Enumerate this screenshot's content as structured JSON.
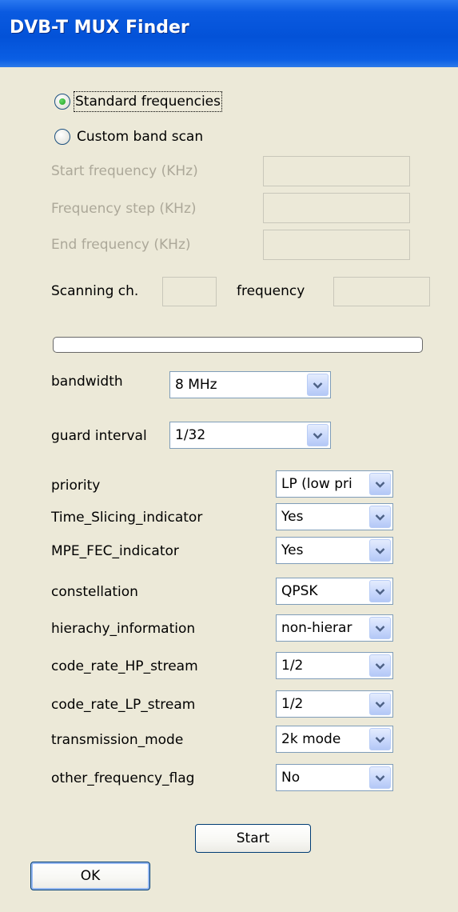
{
  "window": {
    "title": "DVB-T MUX Finder"
  },
  "scan_mode": {
    "standard_label": "Standard frequencies",
    "custom_label": "Custom band scan",
    "selected": "standard"
  },
  "custom_band": {
    "start_label": "Start frequency (KHz)",
    "step_label": "Frequency step (KHz)",
    "end_label": "End frequency (KHz)",
    "start_value": "",
    "step_value": "",
    "end_value": ""
  },
  "scanning": {
    "channel_label": "Scanning ch.",
    "frequency_label": "frequency",
    "channel_value": "",
    "frequency_value": "",
    "progress_percent": 0
  },
  "params": {
    "bandwidth": {
      "label": "bandwidth",
      "value": "8 MHz"
    },
    "guard_interval": {
      "label": "guard interval",
      "value": "1/32"
    },
    "priority": {
      "label": "priority",
      "value": "LP (low pri"
    },
    "time_slicing": {
      "label": "Time_Slicing_indicator",
      "value": "Yes"
    },
    "mpe_fec": {
      "label": "MPE_FEC_indicator",
      "value": "Yes"
    },
    "constellation": {
      "label": "constellation",
      "value": "QPSK"
    },
    "hierarchy": {
      "label": "hierachy_information",
      "value": "non-hierar"
    },
    "code_rate_hp": {
      "label": "code_rate_HP_stream",
      "value": "1/2"
    },
    "code_rate_lp": {
      "label": "code_rate_LP_stream",
      "value": "1/2"
    },
    "transmission_mode": {
      "label": "transmission_mode",
      "value": "2k mode"
    },
    "other_frequency_flag": {
      "label": "other_frequency_flag",
      "value": "No"
    }
  },
  "buttons": {
    "start": "Start",
    "ok": "OK"
  },
  "colors": {
    "titlebar": "#0352d8",
    "window_bg": "#ece9d8",
    "disabled_text": "#aca899",
    "field_border": "#7f9db9",
    "radio_dot": "#21a121"
  },
  "icons": {
    "combo_arrow": "chevron-down-icon"
  }
}
